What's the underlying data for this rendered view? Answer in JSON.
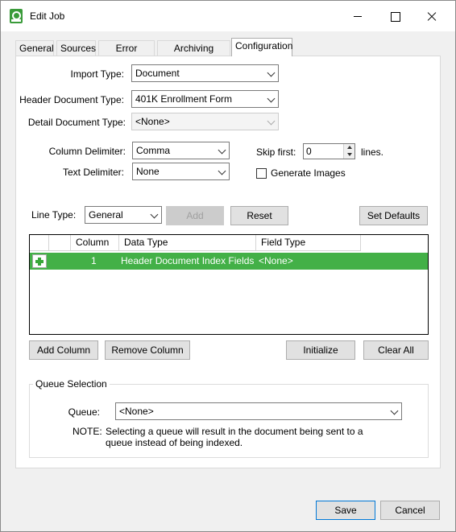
{
  "window": {
    "title": "Edit Job"
  },
  "tabs": [
    "General",
    "Sources",
    "Error Options",
    "Archiving Options",
    "Configuration"
  ],
  "form": {
    "import_type_label": "Import Type:",
    "import_type_value": "Document",
    "header_doc_type_label": "Header Document Type:",
    "header_doc_type_value": "401K Enrollment Form",
    "detail_doc_type_label": "Detail Document Type:",
    "detail_doc_type_value": "<None>",
    "column_delimiter_label": "Column Delimiter:",
    "column_delimiter_value": "Comma",
    "text_delimiter_label": "Text Delimiter:",
    "text_delimiter_value": "None",
    "skip_first_label": "Skip first:",
    "skip_first_value": "0",
    "lines_label": "lines.",
    "generate_images_label": "Generate Images"
  },
  "line_type": {
    "label": "Line Type:",
    "value": "General",
    "add_label": "Add",
    "reset_label": "Reset",
    "set_defaults_label": "Set Defaults"
  },
  "grid": {
    "headers": [
      "Column",
      "Data Type",
      "Field Type"
    ],
    "rows": [
      {
        "column": "1",
        "data_type": "Header Document Index Fields",
        "field_type": "<None>"
      }
    ]
  },
  "grid_buttons": {
    "add_column": "Add Column",
    "remove_column": "Remove Column",
    "initialize": "Initialize",
    "clear_all": "Clear All"
  },
  "queue": {
    "group_title": "Queue Selection",
    "label": "Queue:",
    "value": "<None>",
    "note_label": "NOTE:",
    "note_text_1": "Selecting a queue will result in the document being sent to a",
    "note_text_2": "queue instead of being indexed."
  },
  "footer": {
    "save_label": "Save",
    "cancel_label": "Cancel"
  },
  "colors": {
    "selected_row": "#43b047",
    "accent": "#0078d7"
  }
}
